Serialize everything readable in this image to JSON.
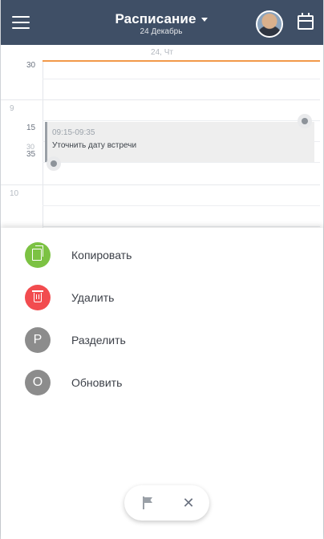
{
  "header": {
    "title": "Расписание",
    "subtitle": "24 Декабрь"
  },
  "calendar": {
    "day_label": "24, Чт",
    "time_labels": {
      "top_partial": "30",
      "hour_9": "9",
      "min_15": "15",
      "min_30": "30",
      "min_35": "35",
      "hour_10": "10"
    },
    "event": {
      "time_range": "09:15-09:35",
      "title": "Уточнить дату встречи"
    }
  },
  "actions": {
    "copy": {
      "label": "Копировать",
      "color": "#7cc243"
    },
    "delete": {
      "label": "Удалить",
      "color": "#f24c4f"
    },
    "split": {
      "label": "Разделить",
      "letter": "P",
      "color": "#8c8c8c"
    },
    "update": {
      "label": "Обновить",
      "letter": "O",
      "color": "#8c8c8c"
    }
  },
  "colors": {
    "header_bg": "#3f4f66",
    "now_line": "#f2994a"
  },
  "bottom_bar": {
    "close_glyph": "✕"
  }
}
